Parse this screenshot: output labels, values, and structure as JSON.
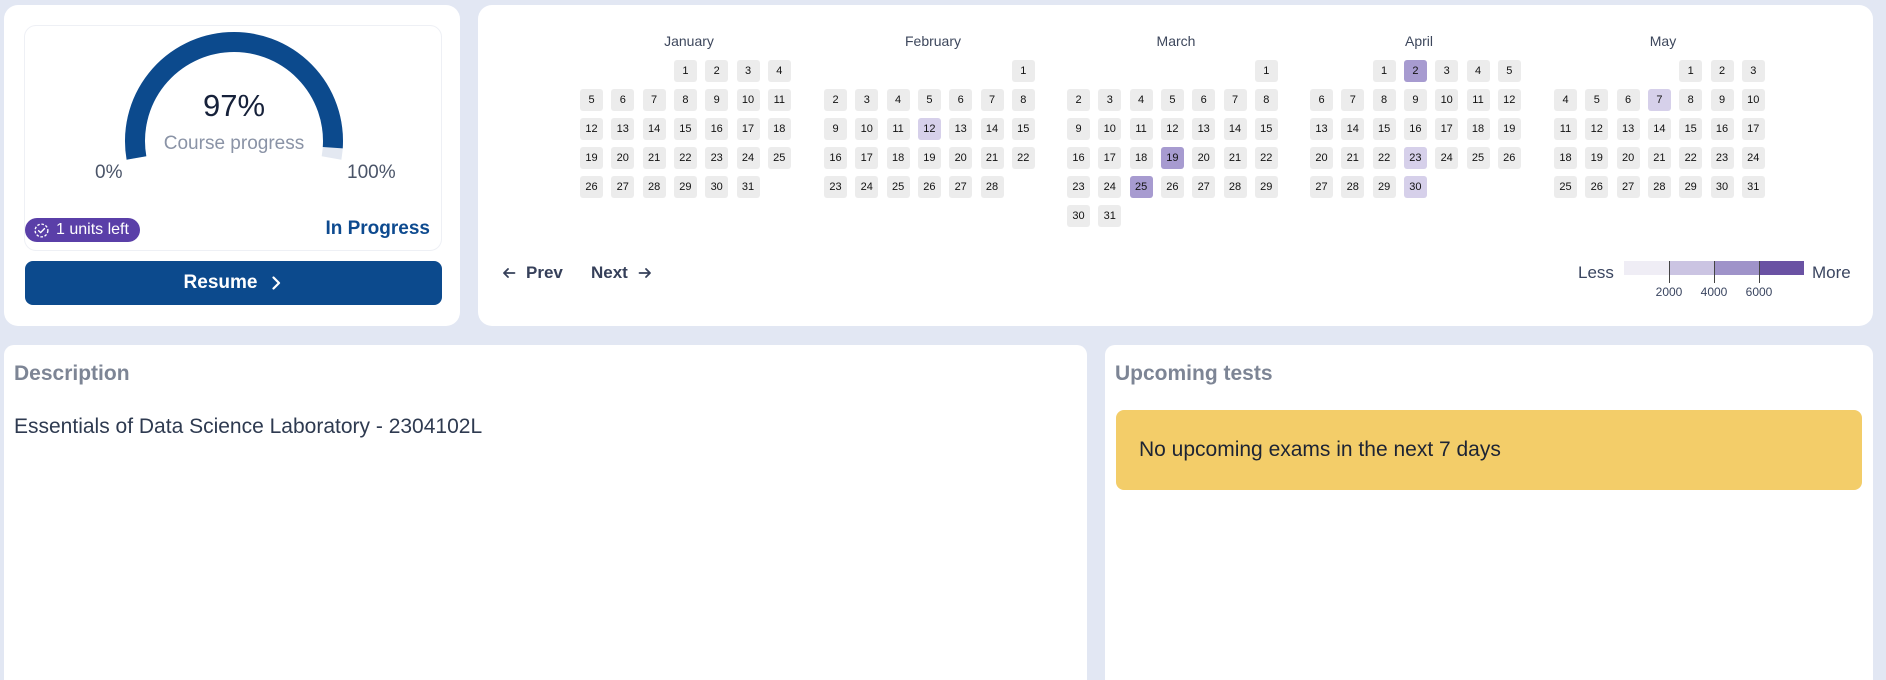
{
  "progress": {
    "percent_label": "97%",
    "percent_value": 97,
    "subtitle": "Course progress",
    "min_label": "0%",
    "max_label": "100%",
    "units_left": "1 units left",
    "status": "In Progress",
    "resume_label": "Resume",
    "colors": {
      "gauge_fill": "#0c4a8d",
      "gauge_track": "#e3e8f1",
      "badge": "#5a3fa8"
    }
  },
  "heatmap": {
    "months": [
      {
        "name": "January",
        "days": 31,
        "offset": 3,
        "levels": {}
      },
      {
        "name": "February",
        "days": 28,
        "offset": 6,
        "levels": {
          "12": 1
        }
      },
      {
        "name": "March",
        "days": 31,
        "offset": 6,
        "levels": {
          "19": 2,
          "25": 2
        }
      },
      {
        "name": "April",
        "days": 30,
        "offset": 2,
        "levels": {
          "2": 2,
          "23": 1,
          "30": 1
        }
      },
      {
        "name": "May",
        "days": 31,
        "offset": 4,
        "levels": {
          "7": 1
        }
      }
    ],
    "prev_label": "Prev",
    "next_label": "Next",
    "legend": {
      "less_label": "Less",
      "more_label": "More",
      "ticks": [
        "2000",
        "4000",
        "6000"
      ],
      "colors": [
        "#efedf5",
        "#cbc4e2",
        "#9f93c9",
        "#6a52a3"
      ]
    },
    "level_colors": [
      "#ececec",
      "#d6d0ea",
      "#a79bd0",
      "#6a52a3"
    ]
  },
  "description": {
    "title": "Description",
    "text": "Essentials of Data Science Laboratory - 2304102L"
  },
  "upcoming": {
    "title": "Upcoming tests",
    "notice": "No upcoming exams in the next 7 days"
  }
}
